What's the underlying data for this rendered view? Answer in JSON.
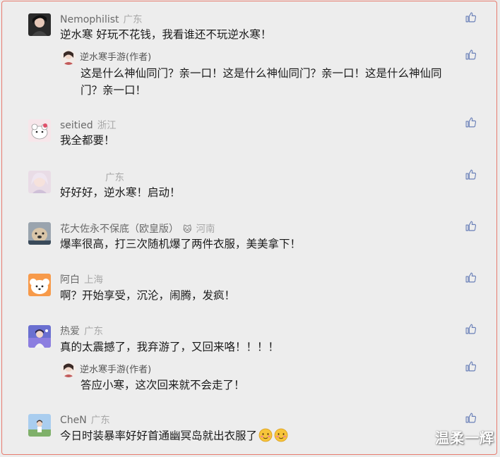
{
  "comments": [
    {
      "user": "Nemophilist",
      "location": "广东",
      "text": "逆水寒 好玩不花钱，我看谁还不玩逆水寒！",
      "reply": {
        "user": "逆水寒手游(作者)",
        "text": "这是什么神仙同门？亲一口！这是什么神仙同门？亲一口！这是什么神仙同门？亲一口！"
      }
    },
    {
      "user": "seitied",
      "location": "浙江",
      "text": "我全都要！"
    },
    {
      "user": "",
      "location": "广东",
      "text": "好好好，逆水寒！启动！"
    },
    {
      "user": "花大佐永不保底（欧皇版）",
      "badge": "🐱",
      "location": "河南",
      "text": "爆率很高，打三次随机爆了两件衣服，美美拿下！"
    },
    {
      "user": "阿白",
      "location": "上海",
      "text": "啊？开始享受，沉沦，闹腾，发疯！"
    },
    {
      "user": "热爱",
      "location": "广东",
      "text": "真的太震撼了，我弃游了，又回来咯！！！！",
      "reply": {
        "user": "逆水寒手游(作者)",
        "text": "答应小寒，这次回来就不会走了！"
      }
    },
    {
      "user": "CheN",
      "location": "广东",
      "text": "今日时装暴率好好首通幽冥岛就出衣服了"
    }
  ],
  "reply_text_line1": "这是什么神仙同门？亲一口！这是什么神仙同门？亲一口！这是什么神仙同",
  "reply_text_line2": "门？亲一口！",
  "icons": {
    "like": "thumbs-up-icon",
    "emoji": "blush-face-emoji"
  },
  "colors": {
    "border": "#e77b6e",
    "background": "#ededed",
    "like": "#6a80b8"
  },
  "watermark": "温柔一辉"
}
